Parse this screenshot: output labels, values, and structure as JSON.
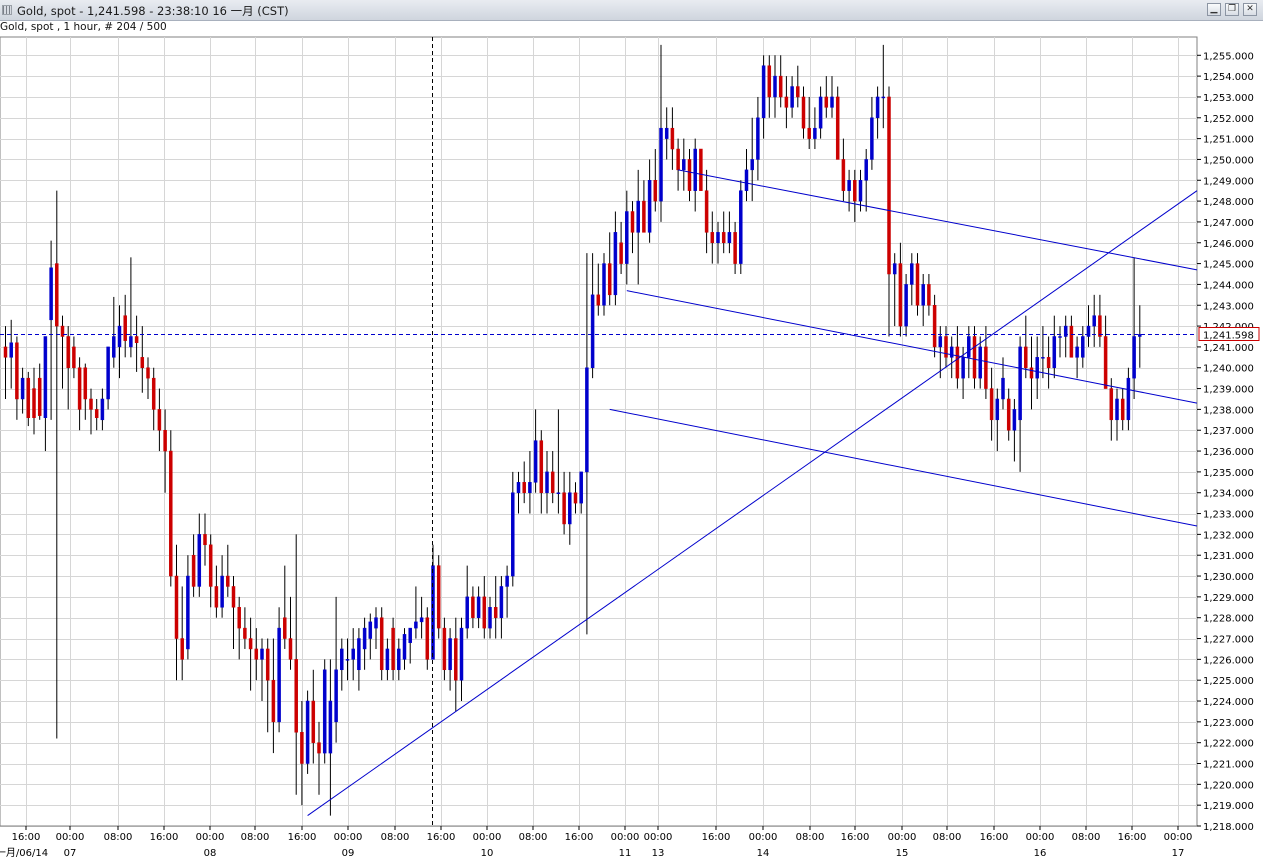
{
  "window": {
    "title": "Gold, spot - 1,241.598 - 23:38:10  16 一月 (CST)",
    "controls": [
      "minimize",
      "restore",
      "close"
    ]
  },
  "chart_header": "Gold, spot , 1 hour, # 204 / 500",
  "colors": {
    "up": "#0000cc",
    "down": "#cc0000",
    "grid": "#d6d6d6",
    "trend": "#0000cc",
    "price_line": "#0000cc",
    "price_label_border": "#cc0000"
  },
  "chart_data": {
    "type": "candlestick",
    "title": "Gold, spot , 1 hour",
    "instrument": "Gold, spot",
    "timeframe": "1 hour",
    "bar_count": "204 / 500",
    "current_price": 1241.598,
    "current_price_label": "1,241.598",
    "y_axis": {
      "min": 1218.0,
      "max": 1255.0,
      "step": 1.0,
      "tick_labels": [
        "1,218.000",
        "1,219.000",
        "1,220.000",
        "1,221.000",
        "1,222.000",
        "1,223.000",
        "1,224.000",
        "1,225.000",
        "1,226.000",
        "1,227.000",
        "1,228.000",
        "1,229.000",
        "1,230.000",
        "1,231.000",
        "1,232.000",
        "1,233.000",
        "1,234.000",
        "1,235.000",
        "1,236.000",
        "1,237.000",
        "1,238.000",
        "1,239.000",
        "1,240.000",
        "1,241.000",
        "1,242.000",
        "1,243.000",
        "1,244.000",
        "1,245.000",
        "1,246.000",
        "1,247.000",
        "1,248.000",
        "1,249.000",
        "1,250.000",
        "1,251.000",
        "1,252.000",
        "1,253.000",
        "1,254.000",
        "1,255.000"
      ]
    },
    "x_axis": {
      "hour_labels": [
        "16:00",
        "00:00",
        "08:00",
        "16:00",
        "00:00",
        "08:00",
        "16:00",
        "00:00",
        "08:00",
        "16:00",
        "00:00",
        "08:00",
        "16:00",
        "00:00",
        "00:00",
        "16:00",
        "00:00",
        "08:00",
        "16:00",
        "00:00",
        "08:00",
        "16:00",
        "00:00",
        "08:00",
        "16:00",
        "00:00"
      ],
      "date_labels": [
        "一月/06/14",
        "07",
        "08",
        "09",
        "10",
        "11",
        "13",
        "14",
        "15",
        "16",
        "17"
      ]
    },
    "ohlc": [
      [
        1241.0,
        1242.0,
        1238.5,
        1240.5
      ],
      [
        1240.5,
        1242.3,
        1239.0,
        1241.2
      ],
      [
        1241.2,
        1241.5,
        1237.5,
        1238.5
      ],
      [
        1238.5,
        1240.0,
        1237.8,
        1239.5
      ],
      [
        1239.5,
        1239.8,
        1237.2,
        1237.6
      ],
      [
        1239.0,
        1240.0,
        1236.8,
        1237.6
      ],
      [
        1239.5,
        1240.2,
        1237.5,
        1237.7
      ],
      [
        1237.6,
        1241.5,
        1236.0,
        1241.5
      ],
      [
        1242.3,
        1246.1,
        1237.5,
        1244.8
      ],
      [
        1245.0,
        1248.5,
        1222.2,
        1242.0
      ],
      [
        1242.0,
        1242.5,
        1239.0,
        1241.5
      ],
      [
        1241.5,
        1242.0,
        1238.0,
        1240.0
      ],
      [
        1241.0,
        1241.5,
        1239.5,
        1240.0
      ],
      [
        1240.0,
        1240.5,
        1237.0,
        1238.0
      ],
      [
        1240.0,
        1240.2,
        1237.5,
        1238.5
      ],
      [
        1238.5,
        1239.0,
        1236.8,
        1238.0
      ],
      [
        1238.0,
        1238.5,
        1237.0,
        1237.6
      ],
      [
        1237.5,
        1239.0,
        1237.0,
        1238.5
      ],
      [
        1238.5,
        1241.0,
        1238.0,
        1241.0
      ],
      [
        1240.5,
        1243.4,
        1240.0,
        1241.5
      ],
      [
        1241.0,
        1243.0,
        1239.5,
        1242.0
      ],
      [
        1242.5,
        1243.5,
        1240.5,
        1241.3
      ],
      [
        1241.0,
        1245.3,
        1240.5,
        1241.5
      ],
      [
        1241.5,
        1242.5,
        1239.8,
        1241.2
      ],
      [
        1240.5,
        1242.0,
        1238.8,
        1240.0
      ],
      [
        1240.0,
        1240.5,
        1238.5,
        1239.5
      ],
      [
        1239.5,
        1240.0,
        1237.0,
        1238.0
      ],
      [
        1238.0,
        1239.0,
        1236.0,
        1237.0
      ],
      [
        1237.0,
        1238.0,
        1234.0,
        1236.0
      ],
      [
        1236.0,
        1237.0,
        1229.5,
        1230.0
      ],
      [
        1230.0,
        1231.5,
        1225.0,
        1227.0
      ],
      [
        1227.0,
        1229.5,
        1225.0,
        1226.0
      ],
      [
        1226.5,
        1231.0,
        1226.0,
        1230.0
      ],
      [
        1231.0,
        1232.0,
        1229.0,
        1229.5
      ],
      [
        1229.5,
        1233.0,
        1229.0,
        1232.0
      ],
      [
        1232.0,
        1233.0,
        1230.5,
        1231.5
      ],
      [
        1231.5,
        1232.0,
        1228.5,
        1229.5
      ],
      [
        1229.5,
        1230.5,
        1228.0,
        1228.5
      ],
      [
        1228.5,
        1231.0,
        1228.0,
        1230.0
      ],
      [
        1230.0,
        1231.5,
        1229.0,
        1229.5
      ],
      [
        1229.5,
        1230.0,
        1226.5,
        1228.5
      ],
      [
        1228.5,
        1229.0,
        1226.0,
        1227.5
      ],
      [
        1227.5,
        1228.5,
        1226.5,
        1227.0
      ],
      [
        1227.0,
        1228.0,
        1224.5,
        1226.5
      ],
      [
        1226.5,
        1227.5,
        1225.0,
        1226.0
      ],
      [
        1226.0,
        1227.0,
        1224.0,
        1226.5
      ],
      [
        1226.5,
        1227.0,
        1222.5,
        1225.0
      ],
      [
        1225.0,
        1227.0,
        1221.5,
        1223.0
      ],
      [
        1223.0,
        1228.5,
        1222.5,
        1227.5
      ],
      [
        1228.0,
        1230.5,
        1226.5,
        1227.0
      ],
      [
        1227.0,
        1229.0,
        1225.5,
        1226.0
      ],
      [
        1226.0,
        1232.0,
        1219.5,
        1222.5
      ],
      [
        1222.5,
        1224.0,
        1219.0,
        1221.0
      ],
      [
        1221.0,
        1224.5,
        1220.5,
        1224.0
      ],
      [
        1224.0,
        1225.5,
        1221.0,
        1222.0
      ],
      [
        1222.0,
        1223.0,
        1219.5,
        1221.5
      ],
      [
        1221.5,
        1226.0,
        1221.0,
        1225.5
      ],
      [
        1221.5,
        1226.0,
        1218.5,
        1224.0
      ],
      [
        1223.0,
        1229.0,
        1222.0,
        1225.5
      ],
      [
        1225.5,
        1227.0,
        1224.5,
        1226.5
      ],
      [
        1226.0,
        1227.0,
        1225.0,
        1226.0
      ],
      [
        1226.0,
        1227.5,
        1225.0,
        1226.5
      ],
      [
        1225.5,
        1227.5,
        1224.5,
        1227.0
      ],
      [
        1226.5,
        1228.0,
        1225.5,
        1227.5
      ],
      [
        1227.0,
        1228.2,
        1226.0,
        1227.8
      ],
      [
        1227.5,
        1228.5,
        1226.5,
        1228.0
      ],
      [
        1228.0,
        1228.5,
        1225.0,
        1225.5
      ],
      [
        1225.5,
        1227.0,
        1225.0,
        1226.5
      ],
      [
        1227.5,
        1228.0,
        1225.0,
        1225.5
      ],
      [
        1225.5,
        1227.0,
        1225.0,
        1226.5
      ],
      [
        1226.0,
        1227.5,
        1225.5,
        1227.2
      ],
      [
        1226.8,
        1227.5,
        1225.8,
        1227.5
      ],
      [
        1227.5,
        1229.5,
        1227.0,
        1227.8
      ],
      [
        1227.8,
        1229.0,
        1227.0,
        1228.0
      ],
      [
        1228.0,
        1228.5,
        1225.5,
        1226.0
      ],
      [
        1226.0,
        1231.5,
        1226.0,
        1230.5
      ],
      [
        1230.5,
        1231.0,
        1227.0,
        1227.5
      ],
      [
        1227.5,
        1228.0,
        1225.0,
        1225.5
      ],
      [
        1225.5,
        1227.5,
        1224.5,
        1227.0
      ],
      [
        1227.0,
        1228.0,
        1223.5,
        1225.0
      ],
      [
        1225.0,
        1228.0,
        1224.0,
        1227.5
      ],
      [
        1227.5,
        1230.5,
        1227.0,
        1229.0
      ],
      [
        1229.0,
        1229.5,
        1227.5,
        1228.0
      ],
      [
        1228.0,
        1229.5,
        1227.5,
        1229.0
      ],
      [
        1229.0,
        1230.0,
        1227.0,
        1227.5
      ],
      [
        1227.5,
        1229.0,
        1227.0,
        1228.5
      ],
      [
        1228.5,
        1230.0,
        1227.0,
        1228.0
      ],
      [
        1228.0,
        1230.0,
        1227.0,
        1229.5
      ],
      [
        1229.5,
        1230.5,
        1228.0,
        1230.0
      ],
      [
        1230.0,
        1235.0,
        1229.5,
        1234.0
      ],
      [
        1234.0,
        1235.0,
        1233.0,
        1234.5
      ],
      [
        1234.5,
        1235.5,
        1233.5,
        1234.0
      ],
      [
        1234.0,
        1236.0,
        1233.0,
        1234.5
      ],
      [
        1234.5,
        1238.0,
        1234.0,
        1236.5
      ],
      [
        1236.5,
        1237.0,
        1233.0,
        1234.0
      ],
      [
        1234.0,
        1236.0,
        1233.0,
        1235.0
      ],
      [
        1235.0,
        1236.0,
        1233.5,
        1234.0
      ],
      [
        1234.0,
        1238.0,
        1233.0,
        1234.0
      ],
      [
        1234.0,
        1235.0,
        1232.0,
        1232.5
      ],
      [
        1232.5,
        1235.0,
        1231.5,
        1234.0
      ],
      [
        1234.0,
        1234.5,
        1233.0,
        1233.5
      ],
      [
        1233.5,
        1235.0,
        1233.0,
        1235.0
      ],
      [
        1235.0,
        1245.5,
        1227.2,
        1240.0
      ],
      [
        1240.0,
        1245.5,
        1239.5,
        1243.5
      ],
      [
        1243.5,
        1245.0,
        1242.5,
        1243.0
      ],
      [
        1243.0,
        1245.5,
        1242.5,
        1245.0
      ],
      [
        1245.0,
        1246.5,
        1243.0,
        1243.5
      ],
      [
        1243.5,
        1247.5,
        1243.0,
        1246.5
      ],
      [
        1246.0,
        1247.0,
        1244.5,
        1245.0
      ],
      [
        1245.0,
        1248.5,
        1244.0,
        1247.5
      ],
      [
        1247.5,
        1248.0,
        1245.5,
        1246.5
      ],
      [
        1246.5,
        1249.5,
        1244.0,
        1248.0
      ],
      [
        1248.0,
        1249.0,
        1246.5,
        1246.5
      ],
      [
        1246.5,
        1250.0,
        1246.0,
        1249.0
      ],
      [
        1249.0,
        1250.5,
        1247.5,
        1248.0
      ],
      [
        1248.0,
        1255.5,
        1247.0,
        1251.5
      ],
      [
        1251.0,
        1252.5,
        1250.0,
        1251.5
      ],
      [
        1251.5,
        1252.5,
        1249.5,
        1250.5
      ],
      [
        1250.5,
        1251.0,
        1248.5,
        1249.5
      ],
      [
        1249.5,
        1251.0,
        1248.5,
        1250.0
      ],
      [
        1250.0,
        1250.5,
        1248.0,
        1248.5
      ],
      [
        1248.5,
        1251.0,
        1247.5,
        1250.5
      ],
      [
        1250.5,
        1250.0,
        1248.5,
        1248.5
      ],
      [
        1248.5,
        1249.5,
        1245.5,
        1246.5
      ],
      [
        1246.5,
        1247.5,
        1245.0,
        1246.0
      ],
      [
        1246.0,
        1247.0,
        1245.0,
        1246.5
      ],
      [
        1246.5,
        1247.5,
        1245.5,
        1246.0
      ],
      [
        1246.0,
        1247.5,
        1245.5,
        1246.5
      ],
      [
        1246.5,
        1247.0,
        1244.5,
        1245.0
      ],
      [
        1245.0,
        1249.0,
        1244.5,
        1248.5
      ],
      [
        1248.5,
        1250.5,
        1248.0,
        1249.5
      ],
      [
        1249.5,
        1252.0,
        1248.0,
        1250.0
      ],
      [
        1250.0,
        1253.0,
        1249.0,
        1252.0
      ],
      [
        1252.0,
        1255.0,
        1251.0,
        1254.5
      ],
      [
        1254.5,
        1255.0,
        1252.0,
        1253.0
      ],
      [
        1253.0,
        1255.0,
        1252.0,
        1254.0
      ],
      [
        1254.0,
        1255.0,
        1252.5,
        1253.0
      ],
      [
        1253.0,
        1254.0,
        1251.5,
        1252.5
      ],
      [
        1252.5,
        1254.0,
        1252.0,
        1253.5
      ],
      [
        1253.5,
        1254.5,
        1252.5,
        1253.0
      ],
      [
        1253.0,
        1253.5,
        1251.0,
        1251.5
      ],
      [
        1251.5,
        1253.0,
        1250.5,
        1251.0
      ],
      [
        1251.0,
        1252.5,
        1250.5,
        1251.5
      ],
      [
        1251.5,
        1253.5,
        1251.0,
        1253.0
      ],
      [
        1253.0,
        1254.0,
        1252.0,
        1252.5
      ],
      [
        1252.5,
        1254.0,
        1252.0,
        1253.0
      ],
      [
        1253.0,
        1253.5,
        1250.0,
        1250.0
      ],
      [
        1250.0,
        1251.0,
        1248.0,
        1248.5
      ],
      [
        1248.5,
        1249.5,
        1247.5,
        1249.0
      ],
      [
        1249.0,
        1249.5,
        1247.0,
        1248.0
      ],
      [
        1248.0,
        1249.5,
        1247.5,
        1249.0
      ],
      [
        1249.0,
        1250.5,
        1247.5,
        1250.0
      ],
      [
        1250.0,
        1253.0,
        1249.5,
        1252.0
      ],
      [
        1252.0,
        1253.5,
        1251.0,
        1253.0
      ],
      [
        1253.0,
        1255.5,
        1251.5,
        1253.0
      ],
      [
        1253.0,
        1253.5,
        1241.5,
        1244.5
      ],
      [
        1244.5,
        1245.5,
        1242.0,
        1245.0
      ],
      [
        1245.0,
        1246.0,
        1241.5,
        1242.0
      ],
      [
        1242.0,
        1244.5,
        1241.5,
        1244.0
      ],
      [
        1244.0,
        1245.5,
        1243.0,
        1245.0
      ],
      [
        1245.0,
        1245.5,
        1242.5,
        1243.0
      ],
      [
        1243.0,
        1244.5,
        1242.0,
        1244.0
      ],
      [
        1244.0,
        1244.5,
        1242.5,
        1243.0
      ],
      [
        1243.0,
        1243.5,
        1240.5,
        1241.0
      ],
      [
        1241.0,
        1242.0,
        1239.5,
        1241.5
      ],
      [
        1241.5,
        1242.0,
        1240.0,
        1240.5
      ],
      [
        1240.5,
        1241.5,
        1239.5,
        1241.0
      ],
      [
        1241.0,
        1242.0,
        1239.0,
        1239.5
      ],
      [
        1239.5,
        1241.0,
        1238.5,
        1240.5
      ],
      [
        1240.5,
        1242.0,
        1239.5,
        1241.5
      ],
      [
        1241.5,
        1242.0,
        1239.0,
        1239.5
      ],
      [
        1239.5,
        1241.5,
        1239.0,
        1241.0
      ],
      [
        1241.0,
        1242.0,
        1238.5,
        1239.0
      ],
      [
        1239.0,
        1240.0,
        1236.5,
        1237.5
      ],
      [
        1237.5,
        1239.0,
        1236.0,
        1238.5
      ],
      [
        1238.5,
        1240.5,
        1238.0,
        1239.5
      ],
      [
        1238.5,
        1239.0,
        1236.5,
        1237.0
      ],
      [
        1237.0,
        1238.5,
        1235.5,
        1238.0
      ],
      [
        1237.5,
        1241.5,
        1235.0,
        1241.0
      ],
      [
        1241.0,
        1242.5,
        1239.5,
        1240.0
      ],
      [
        1240.0,
        1241.5,
        1238.0,
        1239.5
      ],
      [
        1239.5,
        1241.5,
        1238.5,
        1240.5
      ],
      [
        1240.5,
        1242.0,
        1239.5,
        1240.5
      ],
      [
        1240.5,
        1241.5,
        1239.0,
        1240.0
      ],
      [
        1240.0,
        1242.5,
        1239.5,
        1241.5
      ],
      [
        1241.5,
        1242.0,
        1240.5,
        1241.5
      ],
      [
        1241.5,
        1242.5,
        1240.5,
        1242.0
      ],
      [
        1242.0,
        1242.5,
        1240.5,
        1240.5
      ],
      [
        1240.5,
        1241.5,
        1239.5,
        1241.0
      ],
      [
        1240.5,
        1242.0,
        1240.0,
        1241.5
      ],
      [
        1241.5,
        1243.0,
        1241.0,
        1242.0
      ],
      [
        1242.0,
        1243.5,
        1241.0,
        1242.5
      ],
      [
        1242.5,
        1243.5,
        1241.0,
        1241.5
      ],
      [
        1241.5,
        1242.5,
        1239.0,
        1239.0
      ],
      [
        1239.0,
        1239.5,
        1236.5,
        1237.5
      ],
      [
        1237.5,
        1239.0,
        1236.5,
        1238.5
      ],
      [
        1238.5,
        1239.0,
        1237.0,
        1237.5
      ],
      [
        1237.5,
        1240.0,
        1237.0,
        1239.5
      ],
      [
        1239.5,
        1245.3,
        1238.5,
        1241.5
      ],
      [
        1241.5,
        1243.0,
        1240.0,
        1241.6
      ]
    ],
    "trend_lines": [
      {
        "name": "rising support",
        "from": {
          "bar": 53,
          "price": 1218.5
        },
        "to": {
          "bar": "right edge",
          "price": 1248.5
        }
      },
      {
        "name": "channel top",
        "from": {
          "bar": 118,
          "price": 1249.5
        },
        "to": {
          "bar": "right edge",
          "price": 1244.7
        }
      },
      {
        "name": "channel middle",
        "from": {
          "bar": 109,
          "price": 1243.7
        },
        "to": {
          "bar": "right edge",
          "price": 1238.3
        }
      },
      {
        "name": "channel bottom",
        "from": {
          "bar": 106,
          "price": 1238.0
        },
        "to": {
          "bar": "right edge",
          "price": 1232.4
        }
      }
    ],
    "crosshair": {
      "price": 1241.598,
      "vertical_at": "09 15:00"
    },
    "grid": true,
    "legend": "none"
  }
}
